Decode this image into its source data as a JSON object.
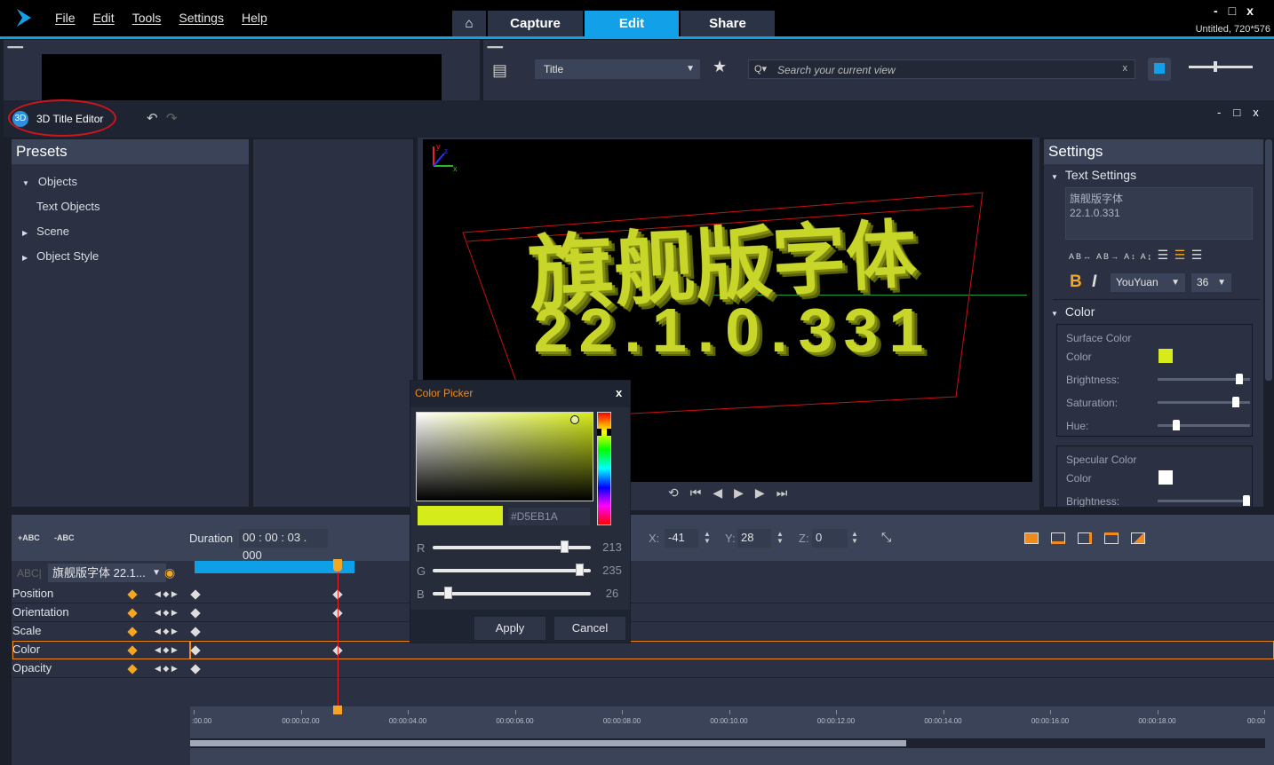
{
  "app": {
    "menu": [
      "File",
      "Edit",
      "Tools",
      "Settings",
      "Help"
    ],
    "tabs": [
      "Capture",
      "Edit",
      "Share"
    ],
    "active_tab": "Edit",
    "project_info": "Untitled, 720*576",
    "accent": "#12A0E8"
  },
  "library": {
    "category": "Title",
    "search_placeholder": "Search your current view"
  },
  "editor": {
    "title": "3D Title Editor",
    "badge": "3D"
  },
  "presets": {
    "header": "Presets",
    "items": [
      {
        "label": "Objects",
        "expanded": true
      },
      {
        "label": "Text Objects",
        "child": true
      },
      {
        "label": "Scene",
        "expanded": false
      },
      {
        "label": "Object Style",
        "expanded": false
      }
    ]
  },
  "preview": {
    "line1": "旗舰版字体",
    "line2": "22.1.0.331",
    "text_color": "#C8D62A",
    "axis": {
      "x": "x",
      "y": "y",
      "z": "z"
    }
  },
  "settings": {
    "header": "Settings",
    "text_section": "Text Settings",
    "text_value_line1": "旗舰版字体",
    "text_value_line2": "22.1.0.331",
    "bold": "B",
    "italic": "I",
    "font": "YouYuan",
    "size": "36",
    "color_section": "Color",
    "surface": {
      "title": "Surface Color",
      "color_label": "Color",
      "color": "#D5EB1A",
      "brightness_label": "Brightness:",
      "brightness": 0.93,
      "saturation_label": "Saturation:",
      "saturation": 0.88,
      "hue_label": "Hue:",
      "hue": 0.2
    },
    "specular": {
      "title": "Specular Color",
      "color_label": "Color",
      "color": "#FFFFFF",
      "brightness_label": "Brightness:",
      "brightness": 0.98
    }
  },
  "color_picker": {
    "title": "Color Picker",
    "hex": "#D5EB1A",
    "r_label": "R",
    "g_label": "G",
    "b_label": "B",
    "r": "213",
    "g": "235",
    "b": "26",
    "apply": "Apply",
    "cancel": "Cancel"
  },
  "timeline": {
    "add_text": "+ABC",
    "remove_text": "-ABC",
    "duration_label": "Duration",
    "duration": "00 : 00 : 03 . 000",
    "layer_prefix": "ABC|",
    "layer": "旗舰版字体 22.1...",
    "rows": [
      "Position",
      "Orientation",
      "Scale",
      "Color",
      "Opacity"
    ],
    "selected_row": "Color",
    "x_label": "X:",
    "x": "-41",
    "y_label": "Y:",
    "y": "28",
    "z_label": "Z:",
    "z": "0",
    "ruler": [
      ":00.00",
      "00:00:02.00",
      "00:00:04.00",
      "00:00:06.00",
      "00:00:08.00",
      "00:00:10.00",
      "00:00:12.00",
      "00:00:14.00",
      "00:00:16.00",
      "00:00:18.00",
      "00:00"
    ]
  }
}
